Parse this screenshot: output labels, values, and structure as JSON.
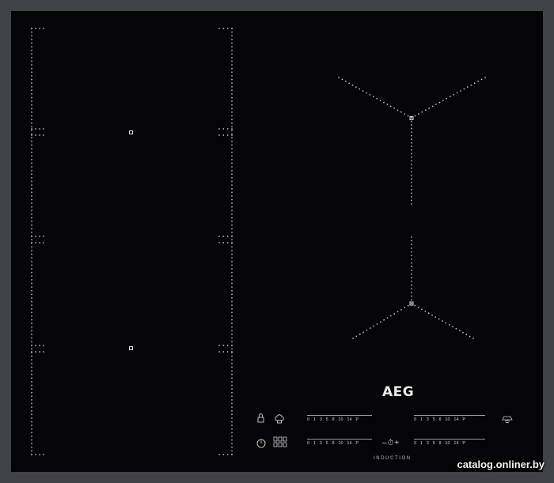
{
  "product": {
    "brand": "AEG",
    "technology_label": "INDUCTION"
  },
  "controls": {
    "power_scale": [
      "0",
      "1",
      "3",
      "5",
      "8",
      "10",
      "14",
      "P"
    ],
    "timer_label": "–⏱+",
    "icons": [
      "lock-icon",
      "chef-hat-icon",
      "power-icon",
      "flexibridge-icon",
      "hob2hood-icon"
    ]
  },
  "watermark": "catalog.onliner.by",
  "colors": {
    "glass": "#050507",
    "frame": "#3f4246",
    "dots": "#d9d9d9"
  }
}
